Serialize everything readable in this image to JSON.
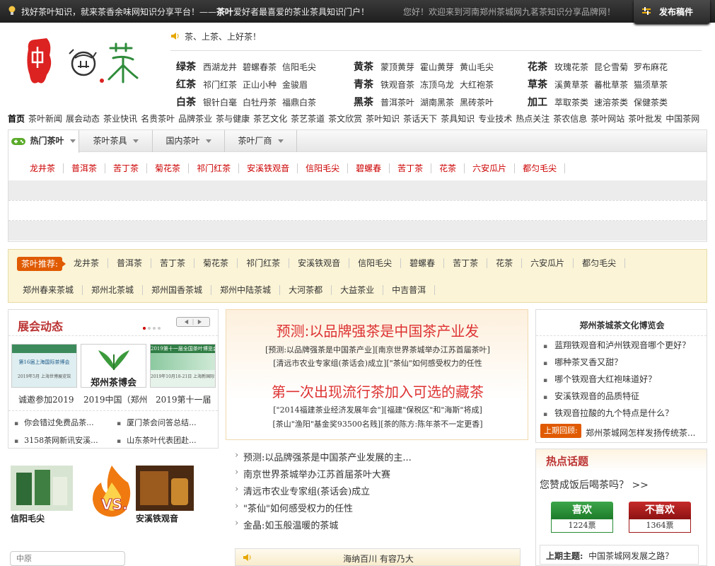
{
  "topbar": {
    "left_text": "找好茶叶知识，就来茶香余味网知识分享平台！——",
    "left_bold": "茶叶",
    "left_rest": "爱好者最喜爱的茶业茶具知识门户！",
    "welcome": "您好！欢迎来到河南郑州茶城网九茗茶知识分享品牌网！",
    "publish": "发布稿件"
  },
  "slogan": "茶、上茶、上好茶！",
  "categories": [
    {
      "head": "绿茶",
      "links": [
        "西湖龙井",
        "碧螺春茶",
        "信阳毛尖"
      ]
    },
    {
      "head": "红茶",
      "links": [
        "祁门红茶",
        "正山小种",
        "金骏眉"
      ]
    },
    {
      "head": "白茶",
      "links": [
        "银针白毫",
        "白牡丹茶",
        "福鼎白茶"
      ]
    },
    {
      "head": "黄茶",
      "links": [
        "蒙顶黄芽",
        "霍山黄芽",
        "黄山毛尖"
      ]
    },
    {
      "head": "青茶",
      "links": [
        "铁观音茶",
        "冻顶乌龙",
        "大红袍茶"
      ]
    },
    {
      "head": "黑茶",
      "links": [
        "普洱茶叶",
        "湖南黑茶",
        "黑砖茶叶"
      ]
    },
    {
      "head": "花茶",
      "links": [
        "玫瑰花茶",
        "昆仑雪菊",
        "罗布麻花"
      ]
    },
    {
      "head": "草茶",
      "links": [
        "溪黄草茶",
        "蕃枇草茶",
        "猫须草茶"
      ]
    },
    {
      "head": "加工",
      "links": [
        "萃取茶类",
        "速溶茶类",
        "保健茶类"
      ]
    }
  ],
  "mainnav": [
    "首页",
    "茶叶新闻",
    "展会动态",
    "茶业快讯",
    "名贵茶叶",
    "品牌茶业",
    "茶与健康",
    "茶艺文化",
    "茶艺茶道",
    "茶文欣赏",
    "茶叶知识",
    "茶话天下",
    "茶具知识",
    "专业技术",
    "热点关注",
    "茶农信息",
    "茶叶网站",
    "茶叶批发",
    "中国茶网"
  ],
  "tabs": [
    "热门茶叶",
    "茶叶茶具",
    "国内茶叶",
    "茶叶厂商"
  ],
  "tea_links": [
    "龙井茶",
    "普洱茶",
    "苦丁茶",
    "菊花茶",
    "祁门红茶",
    "安溪铁观音",
    "信阳毛尖",
    "碧螺春",
    "苦丁茶",
    "花茶",
    "六安瓜片",
    "都匀毛尖"
  ],
  "recommend": {
    "label": "茶叶推荐:",
    "row1": [
      "龙井茶",
      "普洱茶",
      "苦丁茶",
      "菊花茶",
      "祁门红茶",
      "安溪铁观音",
      "信阳毛尖",
      "碧螺春",
      "苦丁茶",
      "花茶",
      "六安瓜片",
      "都匀毛尖"
    ],
    "row2": [
      "郑州春来茶城",
      "郑州北茶城",
      "郑州国香茶城",
      "郑州中陆茶城",
      "大河茶都",
      "大益茶业",
      "中吉普洱"
    ]
  },
  "expo": {
    "title": "展会动态",
    "thumbs": [
      {
        "caption": "诚邀参加2019",
        "img_text": "第16届上海国际茶博会",
        "img_sub": "2019年5月 上海世博展览馆"
      },
      {
        "caption": "2019中国（郑州",
        "img_text": "郑州茶博会",
        "img_sub": ""
      },
      {
        "caption": "2019第十一届",
        "img_text": "2019第十一届全国茶叶博览会",
        "img_sub": "2019年10月18-21日 上海新国际博览中心"
      }
    ],
    "news": [
      "你会错过免费品茶...",
      "厦门茶会问答总结...",
      "3158茶网新讯安溪...",
      "山东茶叶代表团赴..."
    ]
  },
  "vs": {
    "left_label": "信阳毛尖",
    "right_label": "安溪铁观音",
    "mark": "VS."
  },
  "search_placeholder": "中原",
  "center": {
    "headline1": "预测:以品牌强茶是中国茶产业发",
    "sub1a": "[预测:以品牌强茶是中国茶产业][南京世界茶城举办江苏首届茶叶]",
    "sub1b": "[清远市农业专家组(茶话会)成立][\"茶仙\"如何感受权力的任性",
    "headline2": "第一次出现流行茶加入可选的藏茶",
    "sub2a": "[\"2014福建茶业经济发展年会\"][福建\"保税区\"和\"海斯\"将成]",
    "sub2b": "[茶山\"渔阳\"基金奖93500名贱][茶的陈方:陈年茶不一定更香]",
    "list": [
      "预测:以品牌强茶是中国茶产业发展的主...",
      "南京世界茶城举办江苏首届茶叶大赛",
      "清远市农业专家组(茶话会)成立",
      "\"茶仙\"如何感受权力的任性",
      "金晶:如玉般温暖的茶城"
    ],
    "ocean": "海纳百川 有容乃大"
  },
  "museum": {
    "title": "郑州茶城茶文化博览会",
    "items": [
      "蓝翔铁观音和泸州铁观音哪个更好？",
      "哪种茶叉香又甜？",
      "哪个铁观音大红袍味道好？",
      "安溪铁观音的品质特征",
      "铁观音拉酸的九个特点是什么？"
    ],
    "prev_label": "上期回顾:",
    "prev_text": "郑州茶城网怎样发扬传统茶..."
  },
  "hot": {
    "title": "热点话题",
    "question": "您赞成饭后喝茶吗？ >>",
    "like_label": "喜欢",
    "like_count": "1224票",
    "dislike_label": "不喜欢",
    "dislike_count": "1364票",
    "last_label": "上期主题:",
    "last_text": "中国茶城网发展之路？"
  },
  "colors": {
    "accent_red": "#cc0000",
    "orange": "#e05a00",
    "green": "#2a8c36"
  }
}
